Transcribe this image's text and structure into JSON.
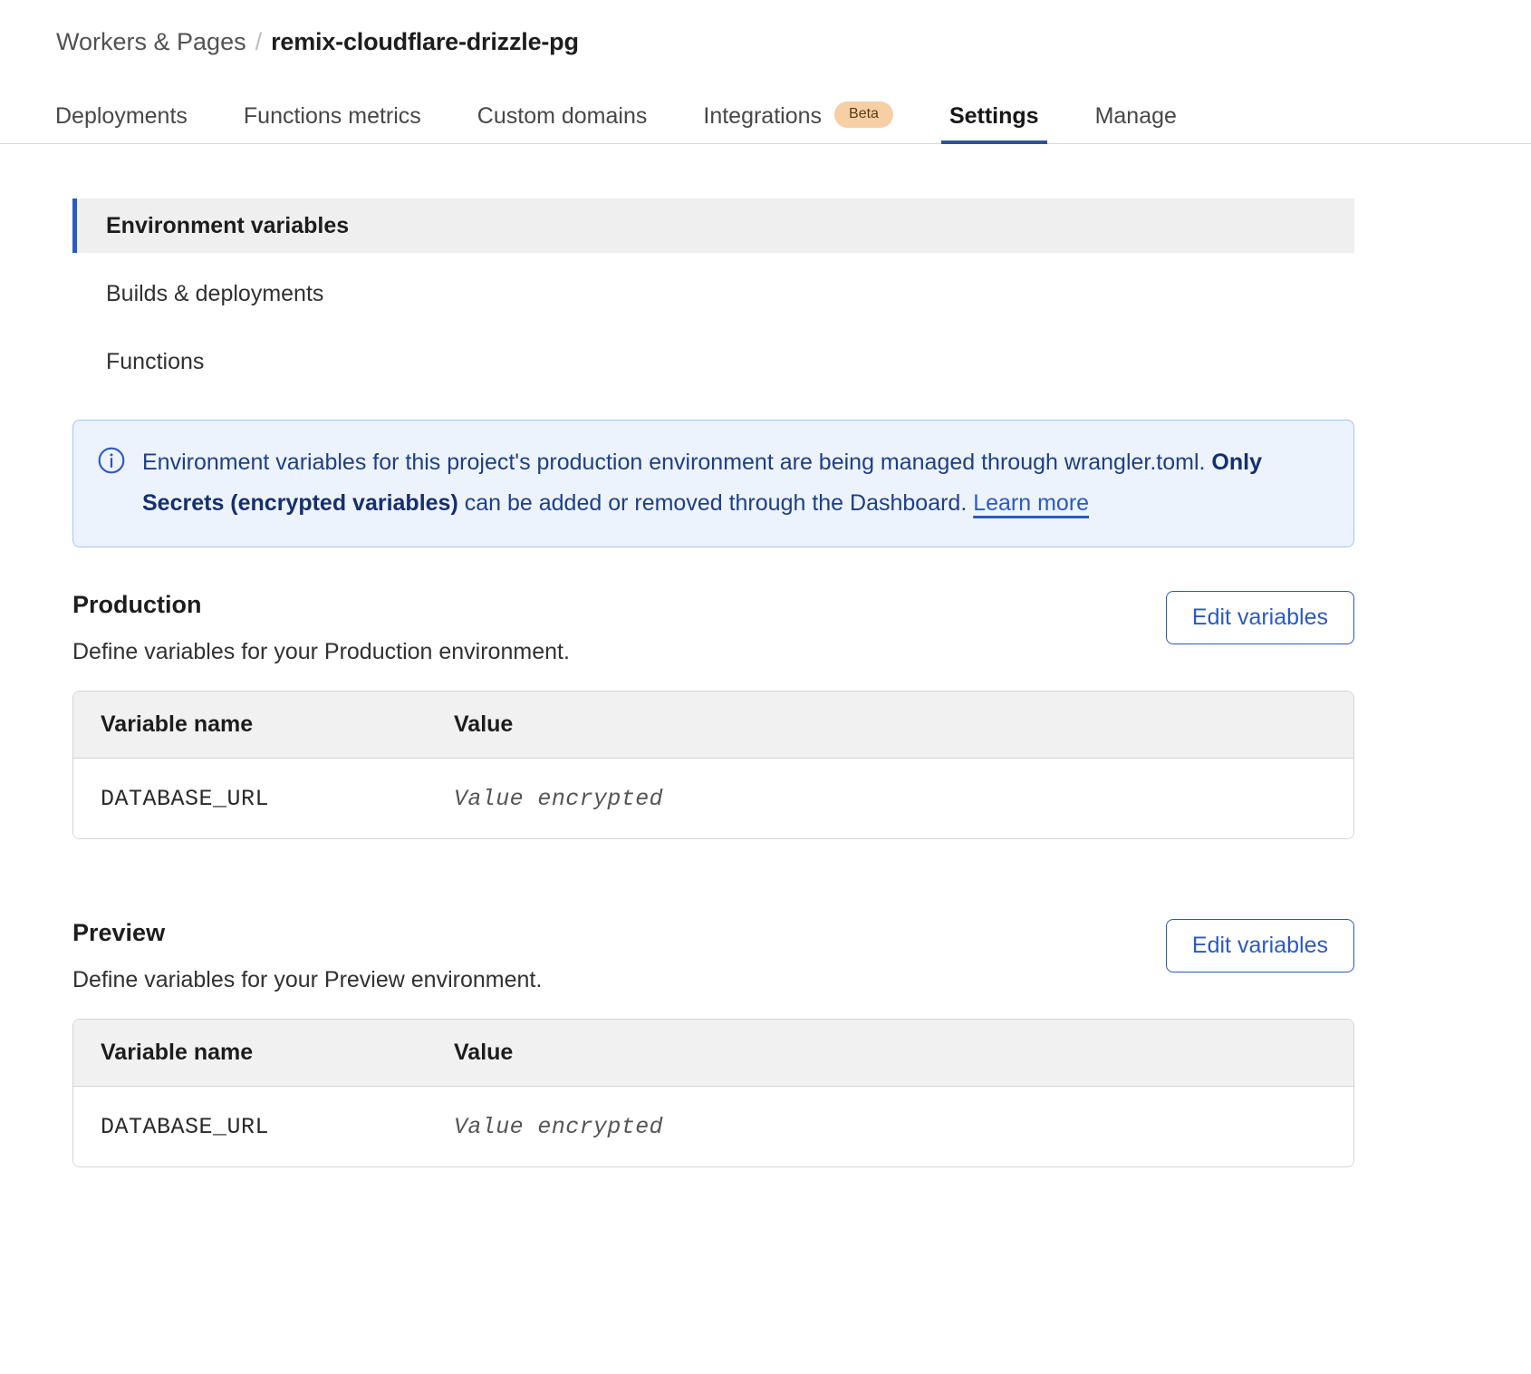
{
  "breadcrumb": {
    "parent": "Workers & Pages",
    "separator": "/",
    "current": "remix-cloudflare-drizzle-pg"
  },
  "tabs": [
    {
      "label": "Deployments",
      "active": false,
      "badge": null
    },
    {
      "label": "Functions metrics",
      "active": false,
      "badge": null
    },
    {
      "label": "Custom domains",
      "active": false,
      "badge": null
    },
    {
      "label": "Integrations",
      "active": false,
      "badge": "Beta"
    },
    {
      "label": "Settings",
      "active": true,
      "badge": null
    },
    {
      "label": "Manage",
      "active": false,
      "badge": null
    }
  ],
  "settings_nav": [
    {
      "label": "Environment variables",
      "active": true
    },
    {
      "label": "Builds & deployments",
      "active": false
    },
    {
      "label": "Functions",
      "active": false
    }
  ],
  "banner": {
    "icon": "info-circle-icon",
    "text_part1": "Environment variables for this project's production environment are being managed through wrangler.toml. ",
    "text_bold": "Only Secrets (encrypted variables)",
    "text_part2": " can be added or removed through the Dashboard. ",
    "link_label": "Learn more"
  },
  "sections": [
    {
      "title": "Production",
      "description": "Define variables for your Production environment.",
      "button_label": "Edit variables",
      "table": {
        "headers": [
          "Variable name",
          "Value"
        ],
        "rows": [
          {
            "name": "DATABASE_URL",
            "value": "Value encrypted"
          }
        ]
      }
    },
    {
      "title": "Preview",
      "description": "Define variables for your Preview environment.",
      "button_label": "Edit variables",
      "table": {
        "headers": [
          "Variable name",
          "Value"
        ],
        "rows": [
          {
            "name": "DATABASE_URL",
            "value": "Value encrypted"
          }
        ]
      }
    }
  ],
  "colors": {
    "accent_blue": "#2b59c3",
    "banner_bg": "#ecf3fd",
    "banner_border": "#a6c4f0",
    "banner_text": "#1e3f86",
    "beta_badge_bg": "#f6cfa4",
    "active_nav_bg": "#efefef",
    "table_header_bg": "#f1f1f1",
    "table_border": "#d4d4d4"
  }
}
